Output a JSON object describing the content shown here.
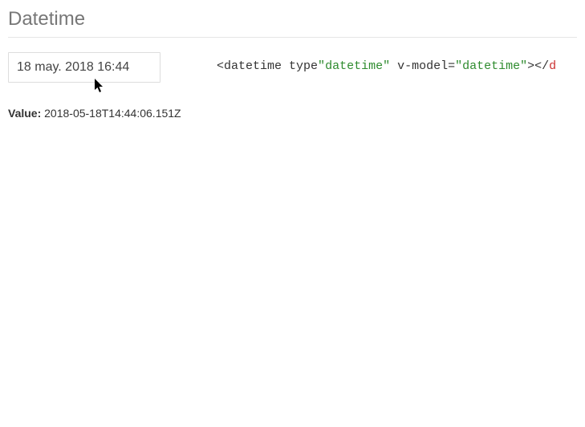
{
  "heading": "Datetime",
  "input_value": "18 may. 2018 16:44",
  "value_label": "Value:",
  "value_text": "2018-05-18T14:44:06.151Z",
  "code": {
    "p1": "<",
    "tag_open": "datetime",
    "attr1_name": " type",
    "q1": "\"",
    "attr1_val": "datetime",
    "q2": "\"",
    "attr2_name": " v-model=",
    "q3": "\"",
    "attr2_val": "datetime",
    "q4": "\"",
    "p2": "></",
    "tag_close_partial": "d"
  }
}
